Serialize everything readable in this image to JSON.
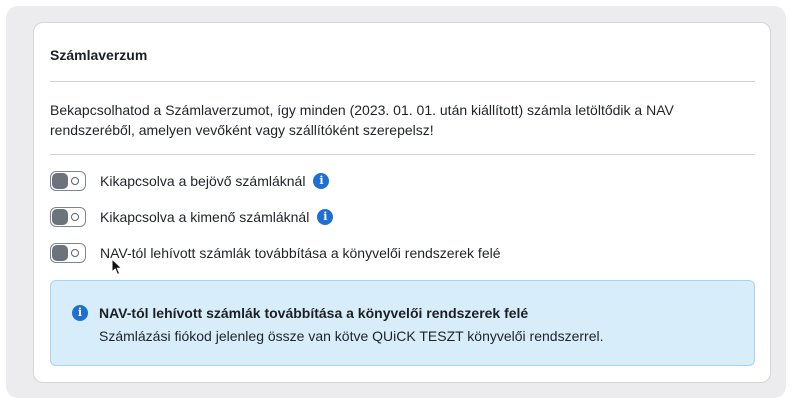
{
  "section": {
    "title": "Számlaverzum",
    "description": "Bekapcsolhatod a Számlaverzumot, így minden (2023. 01. 01. után kiállított) számla letöltődik a NAV rendszeréből, amelyen vevőként vagy szállítóként szerepelsz!"
  },
  "toggles": [
    {
      "label": "Kikapcsolva a bejövő számláknál",
      "state": "off",
      "has_info": true
    },
    {
      "label": "Kikapcsolva a kimenő számláknál",
      "state": "off",
      "has_info": true
    },
    {
      "label": "NAV-tól lehívott számlák továbbítása a könyvelői rendszerek felé",
      "state": "off",
      "has_info": false
    }
  ],
  "alert": {
    "title": "NAV-tól lehívott számlák továbbítása a könyvelői rendszerek felé",
    "text": "Számlázási fiókod jelenleg össze van kötve QUiCK TESZT könyvelői rendszerrel."
  },
  "icons": {
    "info": "info-icon",
    "cursor": "mouse-pointer-icon"
  },
  "colors": {
    "accent": "#1f6fd1",
    "alert_bg": "#d7eefa",
    "alert_border": "#a9d3ee",
    "page_bg": "#ececef"
  }
}
